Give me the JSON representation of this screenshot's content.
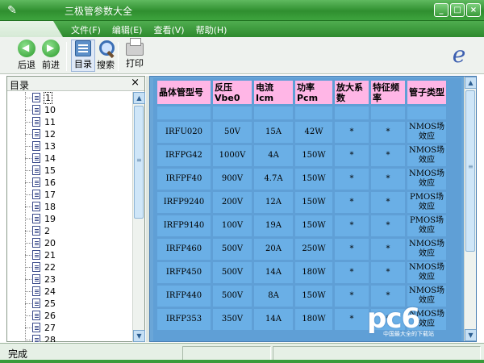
{
  "window": {
    "title": "三极管参数大全"
  },
  "menu": {
    "items": [
      "文件(F)",
      "编辑(E)",
      "查看(V)",
      "帮助(H)"
    ]
  },
  "toolbar": {
    "back": "后退",
    "forward": "前进",
    "toc": "目录",
    "search": "搜索",
    "print": "打印",
    "logo": "e"
  },
  "tree": {
    "title": "目录",
    "close": "×",
    "items": [
      "1",
      "10",
      "11",
      "12",
      "13",
      "14",
      "15",
      "16",
      "17",
      "18",
      "19",
      "2",
      "20",
      "21",
      "22",
      "23",
      "24",
      "25",
      "26",
      "27",
      "28"
    ],
    "selected_index": 0
  },
  "table": {
    "headers": [
      "晶体管型号",
      "反压Vbe0",
      "电流Icm",
      "功率Pcm",
      "放大系数",
      "特征频率",
      "管子类型"
    ],
    "rows": [
      [
        "IRFU020",
        "50V",
        "15A",
        "42W",
        "*",
        "*",
        "NMOS场效应"
      ],
      [
        "IRFPG42",
        "1000V",
        "4A",
        "150W",
        "*",
        "*",
        "NMOS场效应"
      ],
      [
        "IRFPF40",
        "900V",
        "4.7A",
        "150W",
        "*",
        "*",
        "NMOS场效应"
      ],
      [
        "IRFP9240",
        "200V",
        "12A",
        "150W",
        "*",
        "*",
        "PMOS场效应"
      ],
      [
        "IRFP9140",
        "100V",
        "19A",
        "150W",
        "*",
        "*",
        "PMOS场效应"
      ],
      [
        "IRFP460",
        "500V",
        "20A",
        "250W",
        "*",
        "*",
        "NMOS场效应"
      ],
      [
        "IRFP450",
        "500V",
        "14A",
        "180W",
        "*",
        "*",
        "NMOS场效应"
      ],
      [
        "IRFP440",
        "500V",
        "8A",
        "150W",
        "*",
        "*",
        "NMOS场效应"
      ],
      [
        "IRFP353",
        "350V",
        "14A",
        "180W",
        "*",
        "*",
        "NMOS场效应"
      ]
    ]
  },
  "watermark": {
    "brand": "pc6",
    "sub": "中国最大全的下载站"
  },
  "status": {
    "text": "完成"
  },
  "colors": {
    "title_green": "#2f8f2f",
    "header_pink": "#ffb6e6",
    "cell_blue": "#6aafe6",
    "content_blue": "#5f9fd6"
  }
}
